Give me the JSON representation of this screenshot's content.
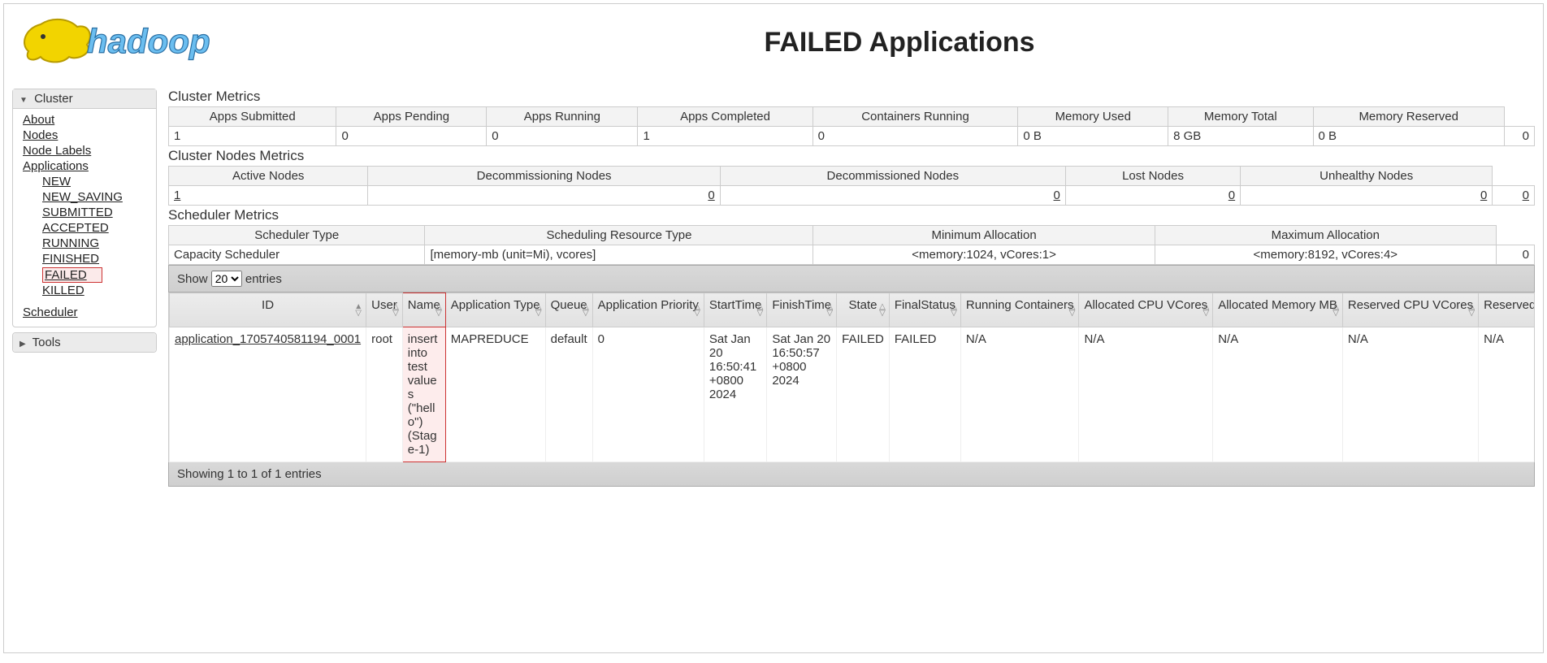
{
  "page_title": "FAILED Applications",
  "sidebar": {
    "cluster_label": "Cluster",
    "tools_label": "Tools",
    "links": {
      "about": "About",
      "nodes": "Nodes",
      "node_labels": "Node Labels",
      "applications": "Applications",
      "states": {
        "new": "NEW",
        "new_saving": "NEW_SAVING",
        "submitted": "SUBMITTED",
        "accepted": "ACCEPTED",
        "running": "RUNNING",
        "finished": "FINISHED",
        "failed": "FAILED",
        "killed": "KILLED"
      },
      "scheduler": "Scheduler"
    }
  },
  "cluster_metrics": {
    "title": "Cluster Metrics",
    "headers": [
      "Apps Submitted",
      "Apps Pending",
      "Apps Running",
      "Apps Completed",
      "Containers Running",
      "Memory Used",
      "Memory Total",
      "Memory Reserved"
    ],
    "values": [
      "1",
      "0",
      "0",
      "1",
      "0",
      "0 B",
      "8 GB",
      "0 B",
      "0"
    ]
  },
  "cluster_nodes_metrics": {
    "title": "Cluster Nodes Metrics",
    "headers": [
      "Active Nodes",
      "Decommissioning Nodes",
      "Decommissioned Nodes",
      "Lost Nodes",
      "Unhealthy Nodes"
    ],
    "values": [
      "1",
      "0",
      "0",
      "0",
      "0",
      "0"
    ]
  },
  "scheduler_metrics": {
    "title": "Scheduler Metrics",
    "headers": [
      "Scheduler Type",
      "Scheduling Resource Type",
      "Minimum Allocation",
      "Maximum Allocation"
    ],
    "values": [
      "Capacity Scheduler",
      "[memory-mb (unit=Mi), vcores]",
      "<memory:1024, vCores:1>",
      "<memory:8192, vCores:4>",
      "0"
    ]
  },
  "datatable": {
    "show_prefix": "Show ",
    "show_suffix": " entries",
    "page_size": "20",
    "status": "Showing 1 to 1 of 1 entries",
    "columns": [
      "ID",
      "User",
      "Name",
      "Application Type",
      "Queue",
      "Application Priority",
      "StartTime",
      "FinishTime",
      "State",
      "FinalStatus",
      "Running Containers",
      "Allocated CPU VCores",
      "Allocated Memory MB",
      "Reserved CPU VCores",
      "Reserved Memory MB"
    ],
    "row": {
      "id": "application_1705740581194_0001",
      "user": "root",
      "name": "insert into test values (\"hello\")(Stage-1)",
      "type": "MAPREDUCE",
      "queue": "default",
      "priority": "0",
      "start": "Sat Jan 20 16:50:41 +0800 2024",
      "finish": "Sat Jan 20 16:50:57 +0800 2024",
      "state": "FAILED",
      "final": "FAILED",
      "rc": "N/A",
      "acpu": "N/A",
      "amem": "N/A",
      "rcpu": "N/A",
      "rmem": "N/A"
    }
  }
}
